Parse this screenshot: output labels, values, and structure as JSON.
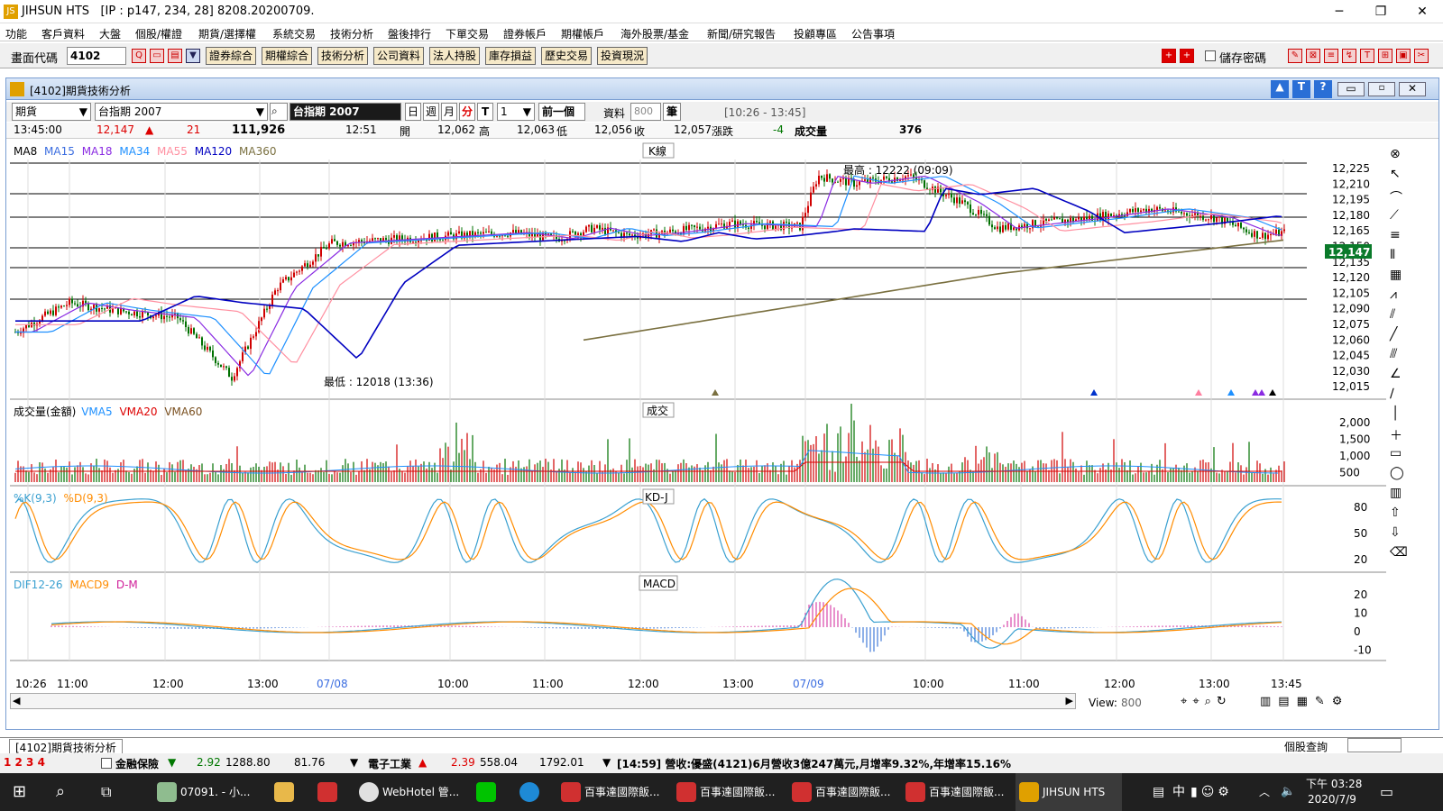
{
  "window": {
    "app_name": "JIHSUN HTS",
    "info": "[IP : p147, 234, 28] 8208.20200709."
  },
  "menu": [
    "功能",
    "客戶資料",
    "大盤",
    "個股/權證",
    "期貨/選擇權",
    "系統交易",
    "技術分析",
    "盤後排行",
    "下單交易",
    "證券帳戶",
    "期權帳戶",
    "海外股票/基金",
    "新聞/研究報告",
    "投顧專區",
    "公告事項"
  ],
  "toolbar": {
    "code_label": "畫面代碼",
    "code_value": "4102",
    "buttons": [
      "證券綜合",
      "期權綜合",
      "技術分析",
      "公司資料",
      "法人持股",
      "庫存損益",
      "歷史交易",
      "投資現況"
    ],
    "save_password": "儲存密碼"
  },
  "subwindow": {
    "title": "[4102]期貨技術分析"
  },
  "controls": {
    "market": "期貨",
    "symbol": "台指期 2007",
    "symbol_display": "台指期 2007",
    "period_buttons": [
      "日",
      "週",
      "月",
      "分",
      "T"
    ],
    "interval": "1",
    "prev_button": "前一個",
    "data_label": "資料",
    "data_count": "800",
    "unit": "筆",
    "range": "[10:26 - 13:45]"
  },
  "quote": {
    "time": "13:45:00",
    "price": "12,147",
    "change": "21",
    "volume_total": "111,926",
    "time2": "12:51",
    "open_label": "開",
    "open": "12,062",
    "high_label": "高",
    "high": "12,063",
    "low_label": "低",
    "low": "12,056",
    "close_label": "收",
    "close": "12,057",
    "chg_label": "漲跌",
    "chg": "-4",
    "vol_label": "成交量",
    "vol": "376"
  },
  "panels": {
    "k_title": "K線",
    "k_legend": [
      "MA8",
      "MA15",
      "MA18",
      "MA34",
      "MA55",
      "MA120",
      "MA360"
    ],
    "k_high_note": "最高 : 12222 (09:09)",
    "k_low_note": "最低 : 12018 (13:36)",
    "vol_title": "成交",
    "vol_legend": [
      "成交量(金額)",
      "VMA5",
      "VMA20",
      "VMA60"
    ],
    "kd_title": "KD-J",
    "kd_legend": [
      "%K(9,3)",
      "%D(9,3)"
    ],
    "macd_title": "MACD",
    "macd_legend": [
      "DIF12-26",
      "MACD9",
      "D-M"
    ]
  },
  "axes": {
    "k_ticks": [
      "12,225",
      "12,210",
      "12,195",
      "12,180",
      "12,165",
      "12,150",
      "12,135",
      "12,120",
      "12,105",
      "12,090",
      "12,075",
      "12,060",
      "12,045",
      "12,030",
      "12,015"
    ],
    "k_last": "12,147",
    "vol_ticks": [
      "2,000",
      "1,500",
      "1,000",
      "500"
    ],
    "kd_ticks": [
      "80",
      "50",
      "20"
    ],
    "macd_ticks": [
      "20",
      "10",
      "0",
      "-10"
    ],
    "x_ticks": [
      "10:26",
      "11:00",
      "12:00",
      "13:00",
      "07/08",
      "10:00",
      "11:00",
      "12:00",
      "13:00",
      "07/09",
      "10:00",
      "11:00",
      "12:00",
      "13:00",
      "13:45"
    ]
  },
  "bottom": {
    "view_label": "View:",
    "view_value": "800",
    "tab": "[4102]期貨技術分析",
    "stock_query": "個股查詢"
  },
  "ticker": {
    "sector1": "金融保險",
    "s1_chg": "2.92",
    "s1_idx": "1288.80",
    "s1_vol": "81.76",
    "sector2": "電子工業",
    "s2_chg": "2.39",
    "s2_idx": "558.04",
    "s2_vol": "1792.01",
    "news": "[14:59] 營收:優盛(4121)6月營收3億247萬元,月增率9.32%,年增率15.16%"
  },
  "taskbar": {
    "items": [
      "07091. - 小...",
      "WebHotel 管...",
      "百事達國際飯...",
      "百事達國際飯...",
      "百事達國際飯...",
      "百事達國際飯...",
      "JIHSUN HTS"
    ],
    "ime": "中",
    "time": "下午 03:28",
    "date": "2020/7/9"
  },
  "colors": {
    "up": "#d00000",
    "down": "#007000",
    "title_bar": "#bcd2ee",
    "button": "#f6e9c8"
  }
}
